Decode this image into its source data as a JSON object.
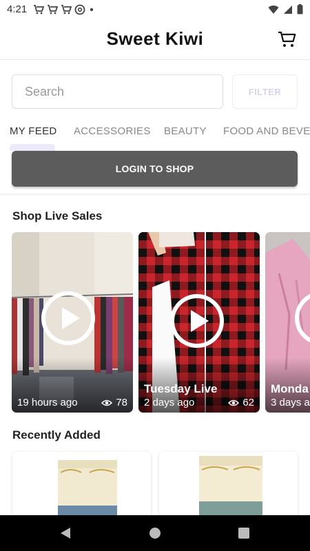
{
  "status": {
    "time": "4:21"
  },
  "header": {
    "title": "Sweet Kiwi"
  },
  "search": {
    "placeholder": "Search",
    "filter_label": "FILTER"
  },
  "tabs": [
    {
      "label": "MY FEED"
    },
    {
      "label": "ACCESSORIES"
    },
    {
      "label": "BEAUTY"
    },
    {
      "label": "FOOD AND BEVE"
    }
  ],
  "login_button": "LOGIN TO SHOP",
  "live_sales": {
    "title": "Shop Live Sales",
    "cards": [
      {
        "title": "",
        "time": "19 hours ago",
        "views": "78"
      },
      {
        "title": "Tuesday Live",
        "time": "2 days ago",
        "views": "62"
      },
      {
        "title": "Monda",
        "time": "3 days a",
        "views": ""
      }
    ]
  },
  "recently_added": {
    "title": "Recently Added"
  },
  "colors": {
    "login_bg": "#5c5c5c",
    "accent_tab": "#ece9fb",
    "buffalo_red": "#c8262c"
  }
}
